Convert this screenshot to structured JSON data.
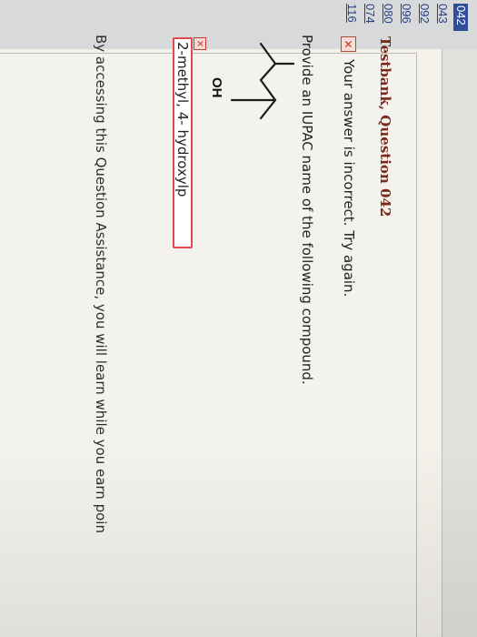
{
  "nav": {
    "items": [
      {
        "label": "042",
        "active": true
      },
      {
        "label": "043"
      },
      {
        "label": "092"
      },
      {
        "label": "096"
      },
      {
        "label": "080"
      },
      {
        "label": "074"
      },
      {
        "label": "116"
      }
    ]
  },
  "question": {
    "title": "Testbank, Question 042",
    "feedback_icon": "x-icon",
    "feedback_text": "Your answer is incorrect.  Try again.",
    "prompt": "Provide an IUPAC name of the following compound.",
    "structure_label": "OH",
    "answer_value": "2-methyl, 4- hydroxylp"
  },
  "assistance": {
    "text": "By accessing this Question Assistance, you will learn while you earn poin"
  },
  "colors": {
    "title": "#7a2a1c",
    "error": "#e04a4a",
    "nav_active_bg": "#2f4f96",
    "nav_link": "#25408f"
  }
}
